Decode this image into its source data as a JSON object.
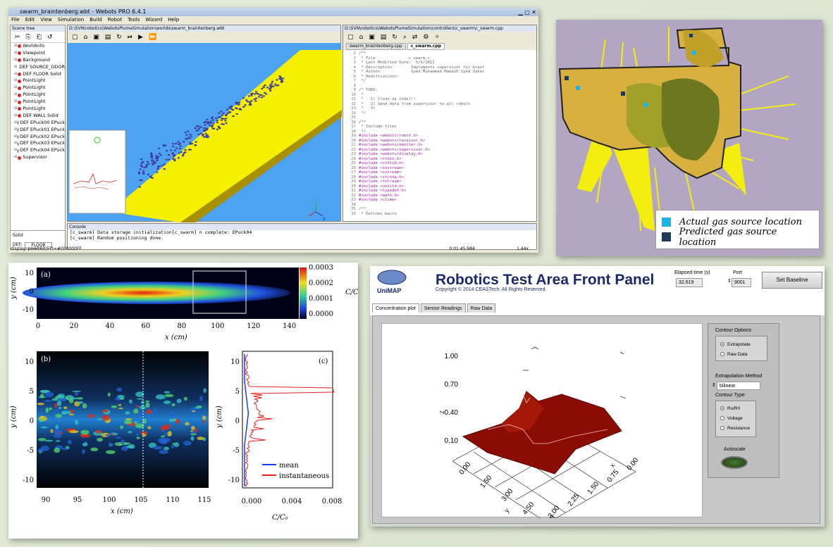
{
  "webots": {
    "title": "swarm_braintenberg.wbt - Webots PRO 6.4.1",
    "menu": [
      "File",
      "Edit",
      "View",
      "Simulation",
      "Build",
      "Robot",
      "Tools",
      "Wizard",
      "Help"
    ],
    "scene_tree_header": "Scene tree",
    "scene_tree": [
      {
        "label": "WorldInfo",
        "kind": "red"
      },
      {
        "label": "Viewpoint",
        "kind": "red"
      },
      {
        "label": "Background",
        "kind": "red"
      },
      {
        "label": "DEF SOURCE_ODOR",
        "kind": "red"
      },
      {
        "label": "DEF FLOOR Solid",
        "kind": "red"
      },
      {
        "label": "PointLight",
        "kind": "red"
      },
      {
        "label": "PointLight",
        "kind": "red"
      },
      {
        "label": "PointLight",
        "kind": "red"
      },
      {
        "label": "PointLight",
        "kind": "red"
      },
      {
        "label": "PointLight",
        "kind": "red"
      },
      {
        "label": "DEF WALL Solid",
        "kind": "red"
      },
      {
        "label": "DEF EPuck00 EPuck",
        "kind": "dark"
      },
      {
        "label": "DEF EPuck01 EPuck",
        "kind": "dark"
      },
      {
        "label": "DEF EPuck02 EPuck",
        "kind": "dark"
      },
      {
        "label": "DEF EPuck03 EPuck",
        "kind": "dark"
      },
      {
        "label": "DEF EPuck04 EPuck",
        "kind": "dark"
      },
      {
        "label": "Supervisor",
        "kind": "red"
      }
    ],
    "selected_node_type": "Solid",
    "selected_def_label": "DEF:",
    "selected_def_value": "FLOOR",
    "view_path": "D:\\SVN\\robotics\\WebotsPlumeSimulation\\worlds\\swarm_braintenberg.wbt",
    "editor_path": "D:\\SVN\\robotics\\WebotsPlumeSimulation\\controllers\\c_swarm\\c_swarm.cpp",
    "editor_tabs": [
      "swarm_braintenberg.cpp",
      "c_swarm.cpp"
    ],
    "code": [
      {
        "n": "1",
        "t": "/**"
      },
      {
        "n": "2",
        "t": " * File              c_swarm.c"
      },
      {
        "n": "3",
        "t": " * Last Modified Date:  5/6/2012"
      },
      {
        "n": "4",
        "t": " * Description        Implements supervisor for brait"
      },
      {
        "n": "5",
        "t": " * Author             Syed Muhammad Mamduh Syed Zakar"
      },
      {
        "n": "6",
        "t": " * Modifications:"
      },
      {
        "n": "7",
        "t": " */"
      },
      {
        "n": "8",
        "t": ""
      },
      {
        "n": "9",
        "t": "/* TODO:"
      },
      {
        "n": "10",
        "t": " *"
      },
      {
        "n": "11",
        "t": " *   1) Clean up code!!!"
      },
      {
        "n": "12",
        "t": " *   2) Send data from supervisor to all robots"
      },
      {
        "n": "13",
        "t": " *   3)"
      },
      {
        "n": "14",
        "t": " */"
      },
      {
        "n": "15",
        "t": ""
      },
      {
        "n": "16",
        "t": "/**"
      },
      {
        "n": "17",
        "t": " * Include files"
      },
      {
        "n": "18",
        "t": " */"
      },
      {
        "n": "19",
        "t": "#include <webots/robot.h>"
      },
      {
        "n": "20",
        "t": "#include <webots/receiver.h>"
      },
      {
        "n": "21",
        "t": "#include <webots/emitter.h>"
      },
      {
        "n": "22",
        "t": "#include <webots/supervisor.h>"
      },
      {
        "n": "23",
        "t": "#include <webots/display.h>"
      },
      {
        "n": "24",
        "t": "#include <stdio.h>"
      },
      {
        "n": "25",
        "t": "#include <stdlib.h>"
      },
      {
        "n": "26",
        "t": "#include <iostream>"
      },
      {
        "n": "27",
        "t": "#include <sstream>"
      },
      {
        "n": "28",
        "t": "#include <string.h>"
      },
      {
        "n": "29",
        "t": "#include <fstream>"
      },
      {
        "n": "30",
        "t": "#include <unistd.h>"
      },
      {
        "n": "31",
        "t": "#include <typedef.h>"
      },
      {
        "n": "32",
        "t": "#include <math.h>"
      },
      {
        "n": "33",
        "t": "#include <ctime>"
      },
      {
        "n": "34",
        "t": ""
      },
      {
        "n": "35",
        "t": "/**"
      },
      {
        "n": "36",
        "t": " * Defines macro"
      }
    ],
    "console_header": "Console",
    "console": [
      "[c_swarm] Data storage initialization[c_swarm] n complete: EPuck04",
      "[c_swarm] Random positioning done."
    ],
    "status_display": "display: pixel(63,57)=#000000FF",
    "status_time": "0:01:45:984",
    "status_speed": "1.44x"
  },
  "gasmap": {
    "legend": [
      {
        "label": "Actual gas source location",
        "color": "#1ab4e6"
      },
      {
        "label": "Predicted gas source location",
        "color": "#1d3a5c"
      }
    ]
  },
  "plume": {
    "a_label": "(a)",
    "b_label": "(b)",
    "c_label": "(c)",
    "a_x_ticks": [
      "0",
      "20",
      "40",
      "60",
      "80",
      "100",
      "120",
      "140"
    ],
    "a_y_ticks": [
      "10",
      "0",
      "-10"
    ],
    "a_xlabel": "x (cm)",
    "a_ylabel": "y (cm)",
    "colorbar_ticks": [
      "0.0003",
      "0.0002",
      "0.0001",
      "0.0000"
    ],
    "colorbar_label": "C/C₀",
    "b_x_ticks": [
      "90",
      "95",
      "100",
      "105",
      "110",
      "115"
    ],
    "b_y_ticks": [
      "10",
      "5",
      "0",
      "-5",
      "-10"
    ],
    "b_xlabel": "x (cm)",
    "b_ylabel": "y (cm)",
    "c_x_ticks": [
      "0.000",
      "0.004",
      "0.008"
    ],
    "c_y_ticks": [
      "10",
      "5",
      "0",
      "-5",
      "-10"
    ],
    "c_ylabel": "y (cm)",
    "c_xlabel": "C/C₀",
    "c_legend": [
      {
        "label": "mean",
        "color": "#1a3cff"
      },
      {
        "label": "instantaneous",
        "color": "#e82020"
      }
    ]
  },
  "labview": {
    "logo_text": "UniMAP",
    "title": "Robotics Test Area Front Panel",
    "copyright": "Copyright © 2014 CEASTech. All Rights Reserved.",
    "elapsed_label": "Elapsed time (s)",
    "elapsed_value": "32.619",
    "port_label": "Port",
    "port_value": "9001",
    "baseline_button": "Set Baseline",
    "tabs": [
      "Concentration plot",
      "Sensor Readings",
      "Raw Data"
    ],
    "contour_options_label": "Contour Options",
    "contour_options": [
      {
        "label": "Extrapolate",
        "selected": true
      },
      {
        "label": "Raw Data",
        "selected": false
      }
    ],
    "extrapolation_label": "Extrapolation Method",
    "extrapolation_value": "bilinear",
    "contour_type_label": "Contour Type",
    "contour_type": [
      {
        "label": "Rs/R0",
        "selected": true
      },
      {
        "label": "Voltage",
        "selected": false
      },
      {
        "label": "Resistance",
        "selected": false
      }
    ],
    "autoscale_label": "Autoscale",
    "z_ticks": [
      "1.00",
      "0.70",
      "0.40",
      "0.10"
    ],
    "z_label": "z",
    "y_ticks": [
      "0.00",
      "1.50",
      "3.00",
      "4.50",
      "6.00"
    ],
    "y_label": "y",
    "x_ticks": [
      "0.00",
      "0.75",
      "1.50",
      "2.25",
      "3.00"
    ],
    "x_label": "x"
  }
}
